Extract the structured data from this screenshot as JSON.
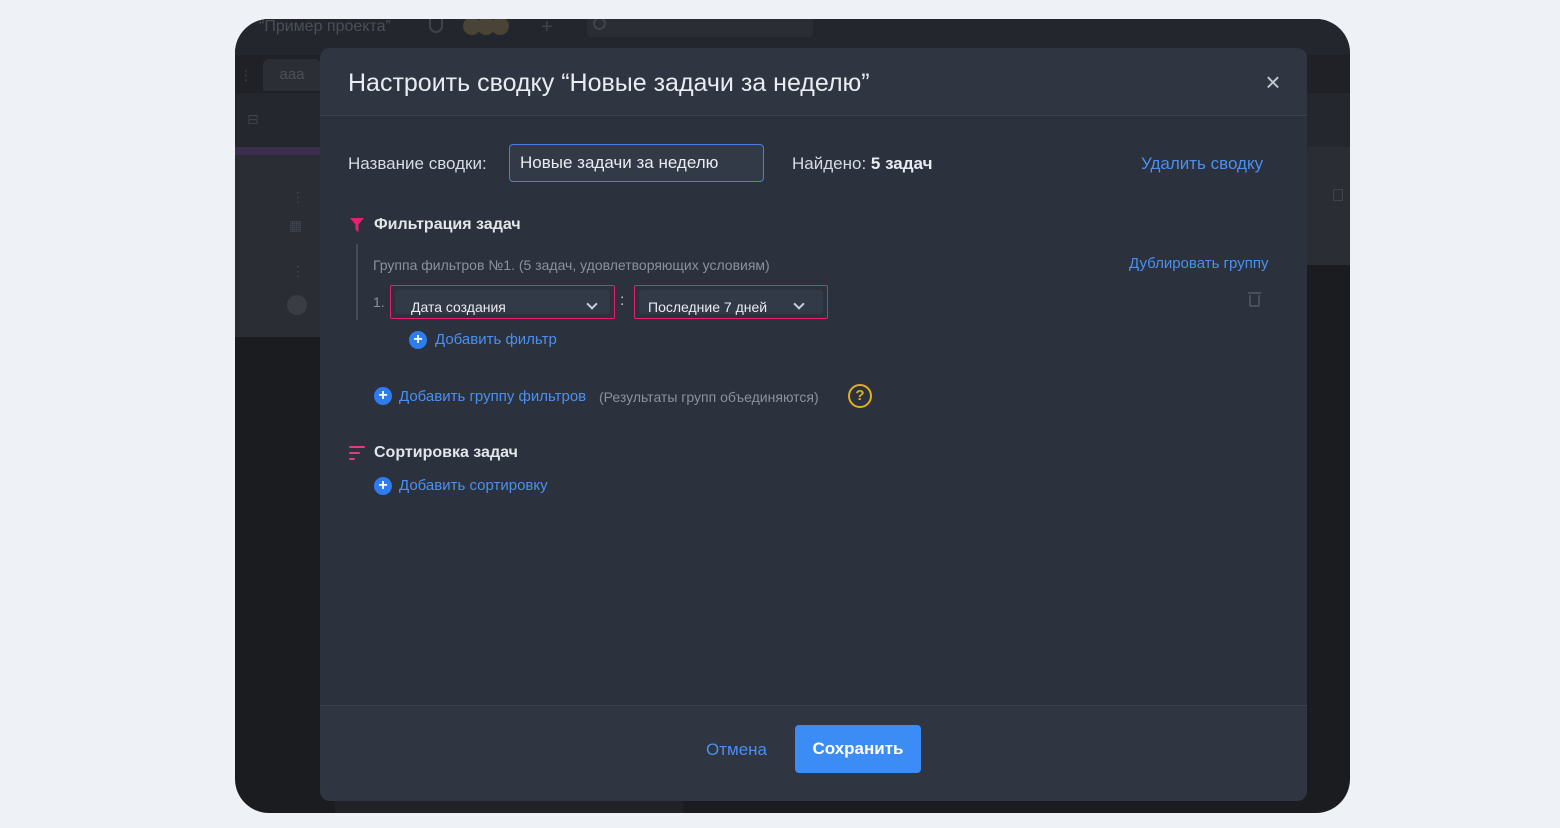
{
  "background_app": {
    "project_title": "“Пример проекта”",
    "tab_label": "aaa"
  },
  "dialog": {
    "title": "Настроить сводку “Новые задачи за неделю”",
    "close_symbol": "×",
    "name_label": "Название сводки:",
    "name_value": "Новые задачи за неделю",
    "found_label": "Найдено:",
    "found_count": "5 задач",
    "delete_link": "Удалить сводку",
    "filter_section_title": "Фильтрация задач",
    "filter_group": {
      "caption": "Группа фильтров №1. (5 задач, удовлетворяющих условиям)",
      "duplicate_link": "Дублировать группу",
      "rows": [
        {
          "number": "1.",
          "field": "Дата создания",
          "separator": ":",
          "value": "Последние 7 дней"
        }
      ],
      "add_filter_link": "Добавить фильтр"
    },
    "add_group_link": "Добавить группу фильтров",
    "add_group_hint": "(Результаты групп объединяются)",
    "help_symbol": "?",
    "sort_section_title": "Сортировка задач",
    "add_sort_link": "Добавить сортировку",
    "cancel_label": "Отмена",
    "save_label": "Сохранить"
  },
  "colors": {
    "accent_blue": "#3b8df5",
    "link_blue": "#4a90f0",
    "highlight_pink": "#e0226f",
    "help_yellow": "#e0b020",
    "dialog_bg": "#2b313d"
  },
  "icons": [
    "filter-icon",
    "sort-icon",
    "close-icon",
    "chevron-down-icon",
    "trash-icon",
    "plus-circle-icon",
    "help-icon"
  ]
}
